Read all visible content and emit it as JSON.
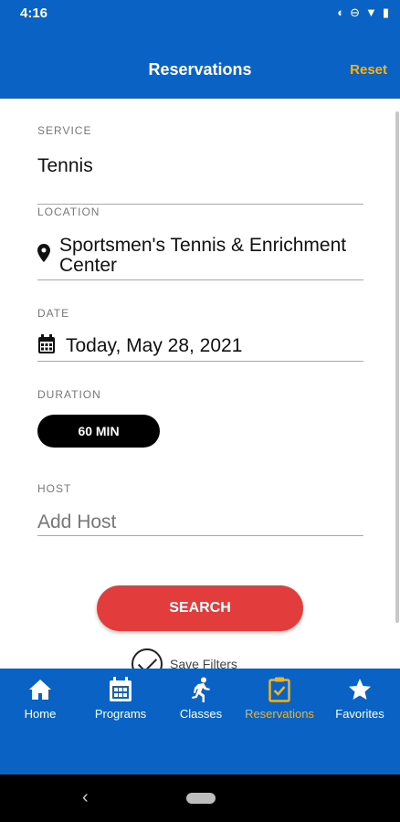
{
  "status_bar": {
    "time": "4:16"
  },
  "header": {
    "title": "Reservations",
    "reset_label": "Reset"
  },
  "form": {
    "service": {
      "label": "SERVICE",
      "value": "Tennis"
    },
    "location": {
      "label": "LOCATION",
      "value_line1": "Sportsmen's Tennis & Enrichment",
      "value_line2": "Center"
    },
    "date": {
      "label": "DATE",
      "value": "Today, May 28, 2021"
    },
    "duration": {
      "label": "DURATION",
      "selected": "60 MIN"
    },
    "host": {
      "label": "HOST",
      "placeholder": "Add Host"
    }
  },
  "search_label": "SEARCH",
  "save_filters_label": "Save Filters",
  "tabs": [
    {
      "label": "Home",
      "icon": "home-icon",
      "active": false
    },
    {
      "label": "Programs",
      "icon": "calendar-icon",
      "active": false
    },
    {
      "label": "Classes",
      "icon": "runner-icon",
      "active": false
    },
    {
      "label": "Reservations",
      "icon": "clipboard-check-icon",
      "active": true
    },
    {
      "label": "Favorites",
      "icon": "star-icon",
      "active": false
    }
  ],
  "colors": {
    "primary": "#0a63c4",
    "accent": "#f0b323",
    "search": "#e23c3c"
  }
}
